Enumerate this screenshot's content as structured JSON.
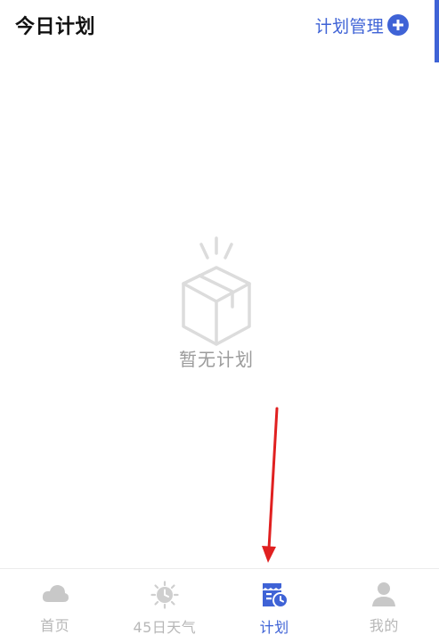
{
  "header": {
    "title": "今日计划",
    "manage_label": "计划管理",
    "manage_icon": "plus-circle-icon"
  },
  "empty_state": {
    "icon": "empty-box-icon",
    "text": "暂无计划"
  },
  "tabbar": {
    "items": [
      {
        "label": "首页",
        "icon": "cloud-icon",
        "active": false
      },
      {
        "label": "45日天气",
        "icon": "sun-clock-icon",
        "active": false
      },
      {
        "label": "计划",
        "icon": "plan-calendar-icon",
        "active": true
      },
      {
        "label": "我的",
        "icon": "person-icon",
        "active": false
      }
    ]
  },
  "colors": {
    "accent": "#3f63d6",
    "inactive": "#b7b7b7",
    "annotation_arrow": "#e02020"
  }
}
